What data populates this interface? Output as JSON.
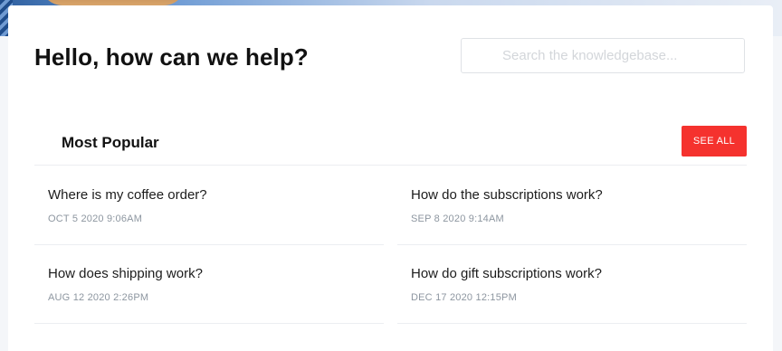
{
  "header": {
    "title": "Hello, how can we help?"
  },
  "search": {
    "placeholder": "Search the knowledgebase...",
    "value": ""
  },
  "popular": {
    "title": "Most Popular",
    "see_all_label": "SEE ALL",
    "articles": [
      {
        "title": "Where is my coffee order?",
        "date": "OCT 5 2020 9:06AM"
      },
      {
        "title": "How do the subscriptions work?",
        "date": "SEP 8 2020 9:14AM"
      },
      {
        "title": "How does shipping work?",
        "date": "AUG 12 2020 2:26PM"
      },
      {
        "title": "How do gift subscriptions work?",
        "date": "DEC 17 2020 12:15PM"
      }
    ]
  },
  "colors": {
    "accent": "#f5322e",
    "text_primary": "#111111",
    "text_muted": "#8d96a0",
    "divider": "#eceef1"
  }
}
